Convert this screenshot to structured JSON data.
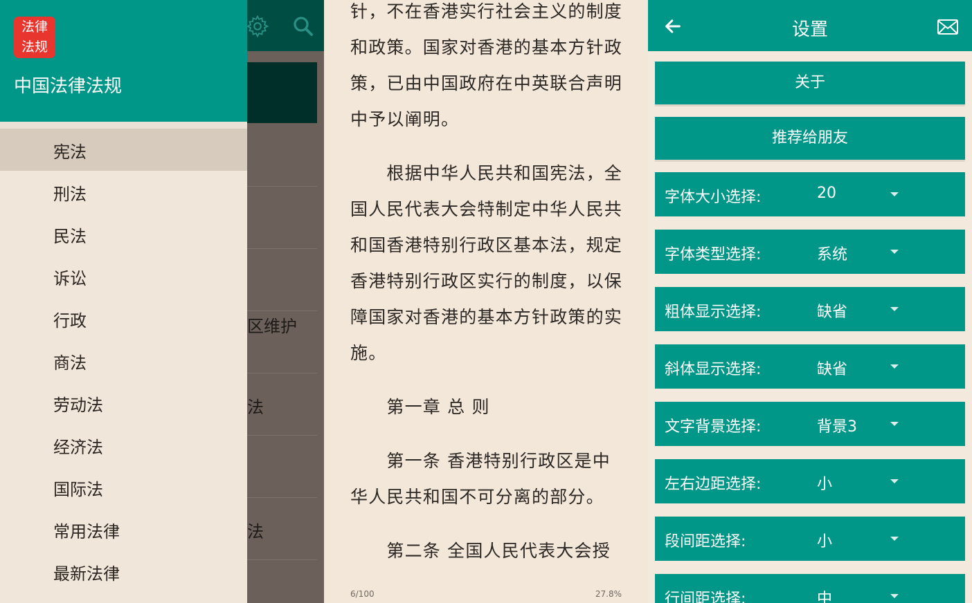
{
  "drawer": {
    "logo_line1": "法律",
    "logo_line2": "法规",
    "app_name": "中国法律法规",
    "items": [
      {
        "label": "宪法",
        "active": true
      },
      {
        "label": "刑法"
      },
      {
        "label": "民法"
      },
      {
        "label": "诉讼"
      },
      {
        "label": "行政"
      },
      {
        "label": "商法"
      },
      {
        "label": "劳动法"
      },
      {
        "label": "经济法"
      },
      {
        "label": "国际法"
      },
      {
        "label": "常用法律"
      },
      {
        "label": "最新法律"
      }
    ]
  },
  "behind_list": {
    "fragments": [
      "区维护",
      "法",
      "法"
    ]
  },
  "reader": {
    "lines": [
      "针，不在香港实行社会主义的制度",
      "和政策。国家对香港的基本方针政",
      "策，已由中国政府在中英联合声明",
      "中予以阐明。",
      "　　根据中华人民共和国宪法，全",
      "国人民代表大会特制定中华人民共",
      "和国香港特别行政区基本法，规定",
      "香港特别行政区实行的制度，以保",
      "障国家对香港的基本方针政策的实",
      "施。",
      "　　第一章 总  则",
      "　　第一条 香港特别行政区是中",
      "华人民共和国不可分离的部分。",
      "　　第二条 全国人民代表大会授"
    ],
    "page_indicator": "6/100",
    "progress": "27.8%"
  },
  "settings": {
    "title": "设置",
    "buttons": {
      "about": "关于",
      "share": "推荐给朋友"
    },
    "rows": [
      {
        "label": "字体大小选择:",
        "value": "20"
      },
      {
        "label": "字体类型选择:",
        "value": "系统"
      },
      {
        "label": "粗体显示选择:",
        "value": "缺省"
      },
      {
        "label": "斜体显示选择:",
        "value": "缺省"
      },
      {
        "label": "文字背景选择:",
        "value": "背景3"
      },
      {
        "label": "左右边距选择:",
        "value": "小"
      },
      {
        "label": "段间距选择:",
        "value": "小"
      },
      {
        "label": "行间距选择:",
        "value": "中"
      }
    ]
  },
  "colors": {
    "teal": "#009688",
    "dark_teal": "#004d44",
    "logo_red": "#e8352d",
    "paper": "#f3e7da"
  },
  "icons": [
    "settings-gear-icon",
    "search-icon",
    "back-arrow-icon",
    "mail-icon"
  ]
}
